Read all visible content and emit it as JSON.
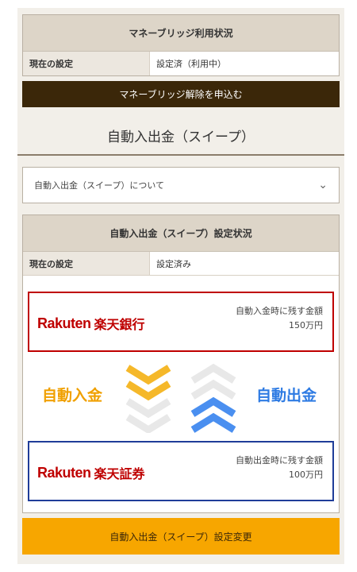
{
  "money_bridge": {
    "header": "マネーブリッジ利用状況",
    "setting_label": "現在の設定",
    "setting_value": "設定済（利用中）",
    "cancel_button": "マネーブリッジ解除を申込む"
  },
  "sweep": {
    "title": "自動入出金（スイープ）",
    "accordion_label": "自動入出金（スイープ）について",
    "status_header": "自動入出金（スイープ）設定状況",
    "setting_label": "現在の設定",
    "setting_value": "設定済み",
    "bank": {
      "logo_text": "Rakuten",
      "logo_jp": "楽天銀行",
      "amount_label": "自動入金時に残す金額",
      "amount_value": "150万円",
      "border_color": "#bf0000"
    },
    "securities": {
      "logo_text": "Rakuten",
      "logo_jp": "楽天証券",
      "amount_label": "自動出金時に残す金額",
      "amount_value": "100万円",
      "border_color": "#1f3d99"
    },
    "auto_deposit_label": "自動入金",
    "auto_withdraw_label": "自動出金",
    "change_button": "自動入出金（スイープ）設定変更"
  },
  "colors": {
    "accent_orange": "#f7a600",
    "dark_brown": "#3b2709",
    "deposit_orange": "#f0a000",
    "withdraw_blue": "#2e7be3"
  },
  "icons": [
    "chevron-down-icon",
    "double-chevron-down-icon",
    "double-chevron-up-icon"
  ]
}
